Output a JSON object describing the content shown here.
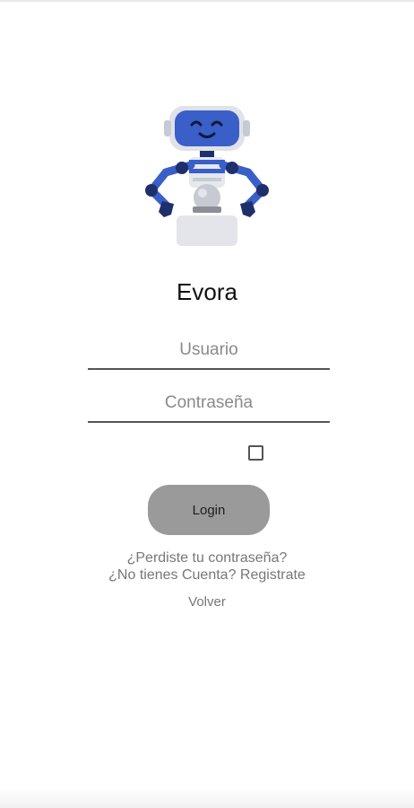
{
  "app": {
    "title": "Evora"
  },
  "form": {
    "username_placeholder": "Usuario",
    "password_placeholder": "Contraseña",
    "remember_checked": false,
    "login_label": "Login"
  },
  "links": {
    "forgot_password": "¿Perdiste tu contraseña?",
    "register": "¿No tienes Cuenta? Registrate",
    "back": "Volver"
  },
  "illustration": {
    "icon": "robot-mascot-icon"
  },
  "colors": {
    "robot_blue": "#3a5fc8",
    "robot_dark": "#1f2f6b",
    "button_gray": "#9a9a9a",
    "underline": "#555555"
  }
}
